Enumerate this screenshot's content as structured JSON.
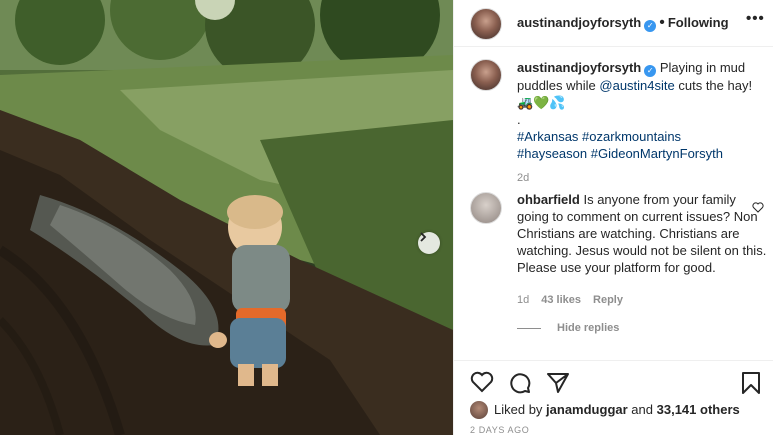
{
  "header": {
    "username": "austinandjoyforsyth",
    "separator": "•",
    "follow_state": "Following",
    "more_label": "•••"
  },
  "caption": {
    "username": "austinandjoyforsyth",
    "text_part1": "Playing in mud puddles while ",
    "mention": "@austin4site",
    "text_part2": " cuts the hay!",
    "emojis": "🚜💚💦",
    "dot": ".",
    "hashtags": [
      "#Arkansas",
      "#ozarkmountains",
      "#hayseason",
      "#GideonMartynForsyth"
    ],
    "age": "2d"
  },
  "comment": {
    "username": "ohbarfield",
    "text": "Is anyone from your family going to comment on current issues? Non Christians are watching. Christians are watching. Jesus would not be silent on this. Please use your platform for good.",
    "age": "1d",
    "likes": "43 likes",
    "reply": "Reply",
    "hide_replies": "Hide replies"
  },
  "likes": {
    "prefix": "Liked by",
    "user": "janamduggar",
    "connector": "and",
    "count": "33,141 others"
  },
  "post_age": "2 DAYS AGO",
  "icons": [
    "like-icon",
    "comment-icon",
    "share-icon",
    "save-icon",
    "verified-icon",
    "next-arrow-icon",
    "comment-heart-icon"
  ],
  "colors": {
    "verified": "#3897f0",
    "link": "#00376b",
    "muted": "#8e8e8e"
  }
}
